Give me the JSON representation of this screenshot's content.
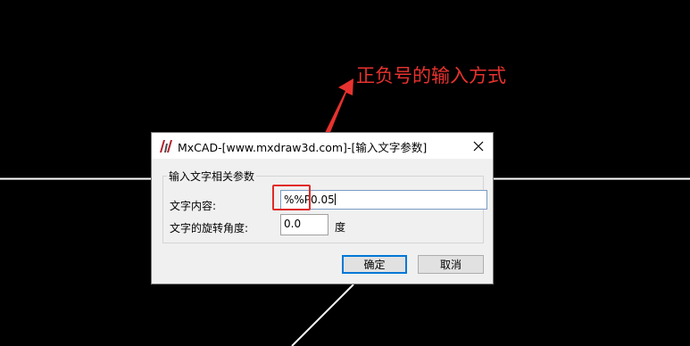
{
  "annotation": {
    "text": "正负号的输入方式",
    "color": "#e8322f"
  },
  "dialog": {
    "title": "MxCAD-[www.mxdraw3d.com]-[输入文字参数]",
    "close_icon": "close-icon",
    "group_label": "输入文字相关参数",
    "text_content_label": "文字内容:",
    "text_content_value": "%%P0.05",
    "rotation_label": "文字的旋转角度:",
    "rotation_value": "0.0",
    "rotation_unit": "度",
    "ok_label": "确定",
    "cancel_label": "取消"
  },
  "colors": {
    "background": "#000000",
    "cad_line": "#ffffff",
    "annotation_red": "#e02a26",
    "accent_blue": "#0078d7"
  }
}
